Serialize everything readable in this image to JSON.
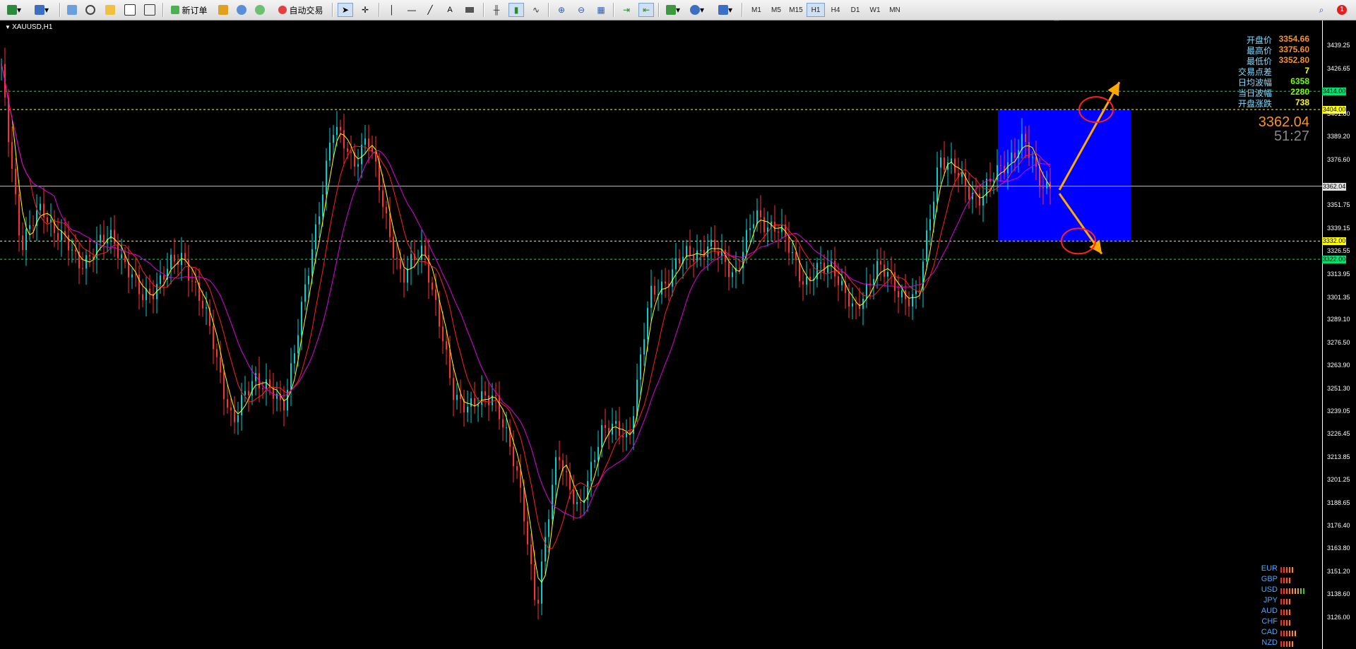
{
  "toolbar": {
    "new_order_label": "新订单",
    "auto_trade_label": "自动交易",
    "timeframes": [
      "M1",
      "M5",
      "M15",
      "H1",
      "H4",
      "D1",
      "W1",
      "MN"
    ],
    "active_timeframe": "H1",
    "notification_count": "1"
  },
  "chart": {
    "symbol": "XAUUSD,H1",
    "bid_price": "3362.04",
    "countdown": "51:27",
    "info_panel": [
      {
        "label": "开盘价",
        "value": "3354.66",
        "color": "#f7941d"
      },
      {
        "label": "最高价",
        "value": "3375.60",
        "color": "#f7941d"
      },
      {
        "label": "最低价",
        "value": "3352.80",
        "color": "#f7941d"
      },
      {
        "label": "交易点差",
        "value": "7",
        "color": "#ffff00"
      },
      {
        "label": "日均波幅",
        "value": "6358",
        "color": "#7cfc00"
      },
      {
        "label": "当日波幅",
        "value": "2280",
        "color": "#7cfc00"
      },
      {
        "label": "开盘涨跌",
        "value": "738",
        "color": "#ffff00"
      }
    ],
    "price_axis": [
      "3439.25",
      "3426.65",
      "3414.00",
      "3404.00",
      "3401.80",
      "3389.20",
      "3376.60",
      "3362.04",
      "3351.75",
      "3339.15",
      "3332.00",
      "3326.55",
      "3322.00",
      "3313.95",
      "3301.35",
      "3289.10",
      "3276.50",
      "3263.90",
      "3251.30",
      "3239.05",
      "3226.45",
      "3213.85",
      "3201.25",
      "3188.65",
      "3176.40",
      "3163.80",
      "3151.20",
      "3138.60",
      "3126.00"
    ],
    "levels": [
      {
        "price": "3414.00",
        "color": "#00e070"
      },
      {
        "price": "3404.00",
        "color": "#ffff00"
      },
      {
        "price": "3362.04",
        "color": "#c0c0c0"
      },
      {
        "price": "3332.00",
        "color": "#ffff00"
      },
      {
        "price": "3322.00",
        "color": "#00e070"
      }
    ],
    "currency_strength": [
      {
        "name": "EUR",
        "bars": 5
      },
      {
        "name": "GBP",
        "bars": 4
      },
      {
        "name": "USD",
        "bars": 9
      },
      {
        "name": "JPY",
        "bars": 4
      },
      {
        "name": "AUD",
        "bars": 4
      },
      {
        "name": "CHF",
        "bars": 4
      },
      {
        "name": "CAD",
        "bars": 6
      },
      {
        "name": "NZD",
        "bars": 5
      }
    ],
    "colors": {
      "bull_candle": "#00d0d0",
      "bear_candle": "#ff3030",
      "ma_fast": "#ffff00",
      "ma_mid": "#ff2020",
      "ma_slow": "#e000e0",
      "zone": "#0000ff",
      "arrow": "#ffaa00",
      "circle": "#ff2020"
    }
  }
}
